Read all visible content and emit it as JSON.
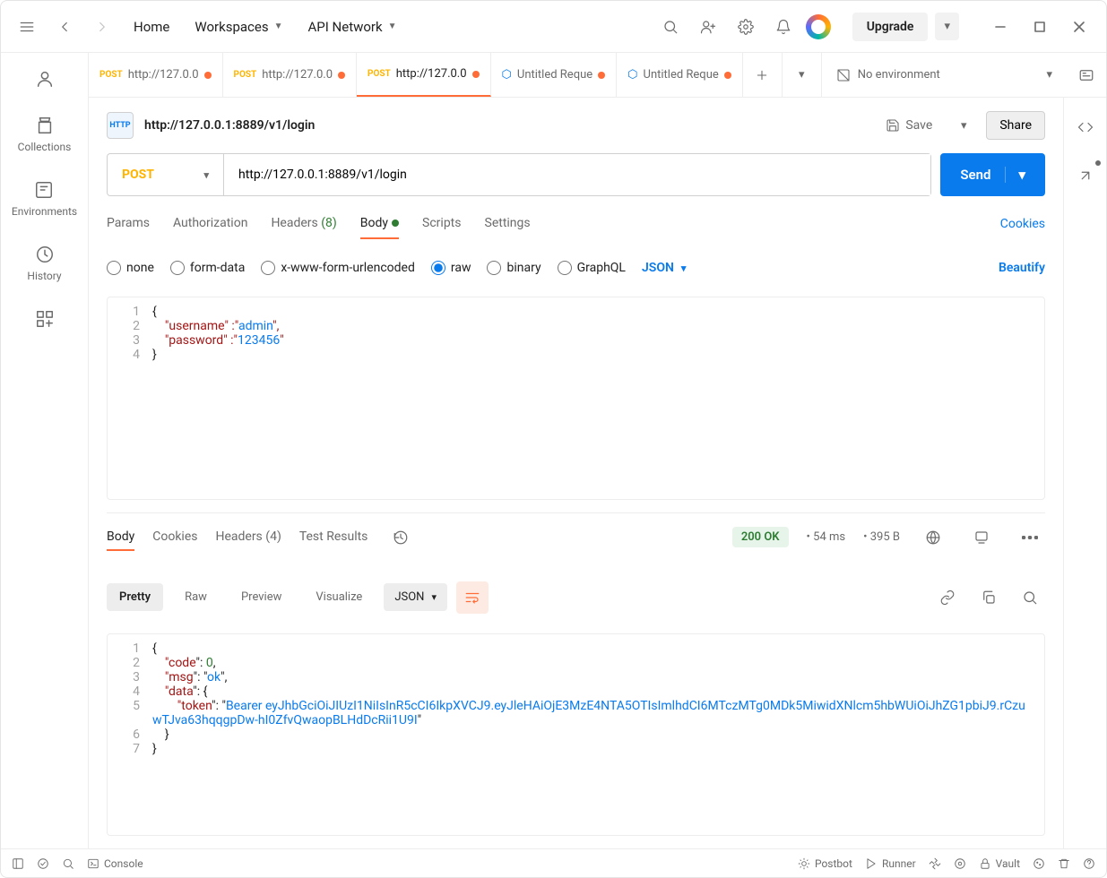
{
  "topnav": {
    "home": "Home",
    "workspaces": "Workspaces",
    "apiNetwork": "API Network",
    "upgrade": "Upgrade"
  },
  "sidebar": {
    "collections": "Collections",
    "environments": "Environments",
    "history": "History"
  },
  "tabs": [
    {
      "method": "POST",
      "label": "http://127.0.0",
      "dirty": true,
      "type": "http"
    },
    {
      "method": "POST",
      "label": "http://127.0.0",
      "dirty": true,
      "type": "http"
    },
    {
      "method": "POST",
      "label": "http://127.0.0",
      "dirty": true,
      "type": "http",
      "active": true
    },
    {
      "method": "",
      "label": "Untitled Reque",
      "dirty": true,
      "type": "gql"
    },
    {
      "method": "",
      "label": "Untitled Reque",
      "dirty": true,
      "type": "gql"
    }
  ],
  "environment": "No environment",
  "request": {
    "title": "http://127.0.0.1:8889/v1/login",
    "method": "POST",
    "url": "http://127.0.0.1:8889/v1/login",
    "save": "Save",
    "share": "Share",
    "send": "Send"
  },
  "reqTabs": {
    "params": "Params",
    "auth": "Authorization",
    "headers": "Headers",
    "headersCount": "(8)",
    "body": "Body",
    "scripts": "Scripts",
    "settings": "Settings",
    "cookies": "Cookies"
  },
  "bodyTypes": {
    "none": "none",
    "formData": "form-data",
    "urlencoded": "x-www-form-urlencoded",
    "raw": "raw",
    "binary": "binary",
    "graphql": "GraphQL",
    "format": "JSON",
    "beautify": "Beautify"
  },
  "reqBody": {
    "l1": "{",
    "l2a": "    \"",
    "l2k": "username",
    "l2b": "\" :\"",
    "l2v": "admin",
    "l2c": "\",",
    "l3a": "    \"",
    "l3k": "password",
    "l3b": "\" :\"",
    "l3v": "123456",
    "l3c": "\"",
    "l4": "}"
  },
  "respTabs": {
    "body": "Body",
    "cookies": "Cookies",
    "headers": "Headers",
    "headersCount": "(4)",
    "testResults": "Test Results"
  },
  "respMeta": {
    "status": "200 OK",
    "time": "54 ms",
    "size": "395 B"
  },
  "viewModes": {
    "pretty": "Pretty",
    "raw": "Raw",
    "preview": "Preview",
    "visualize": "Visualize",
    "format": "JSON"
  },
  "respBody": {
    "l1": "{",
    "l2a": "    \"",
    "l2k": "code",
    "l2b": "\": ",
    "l2v": "0",
    "l2c": ",",
    "l3a": "    \"",
    "l3k": "msg",
    "l3b": "\": \"",
    "l3v": "ok",
    "l3c": "\",",
    "l4a": "    \"",
    "l4k": "data",
    "l4b": "\": {",
    "l5a": "        \"",
    "l5k": "token",
    "l5b": "\": \"",
    "l5v": "Bearer eyJhbGciOiJIUzI1NiIsInR5cCI6IkpXVCJ9.eyJleHAiOjE3MzE4NTA5OTIsImlhdCI6MTczMTg0MDk5MiwidXNlcm5hbWUiOiJhZG1pbiJ9.rCzuwTJva63hqqgpDw-hI0ZfvQwaopBLHdDcRii1U9I",
    "l5c": "\"",
    "l6": "    }",
    "l7": "}"
  },
  "statusbar": {
    "console": "Console",
    "postbot": "Postbot",
    "runner": "Runner",
    "vault": "Vault"
  }
}
